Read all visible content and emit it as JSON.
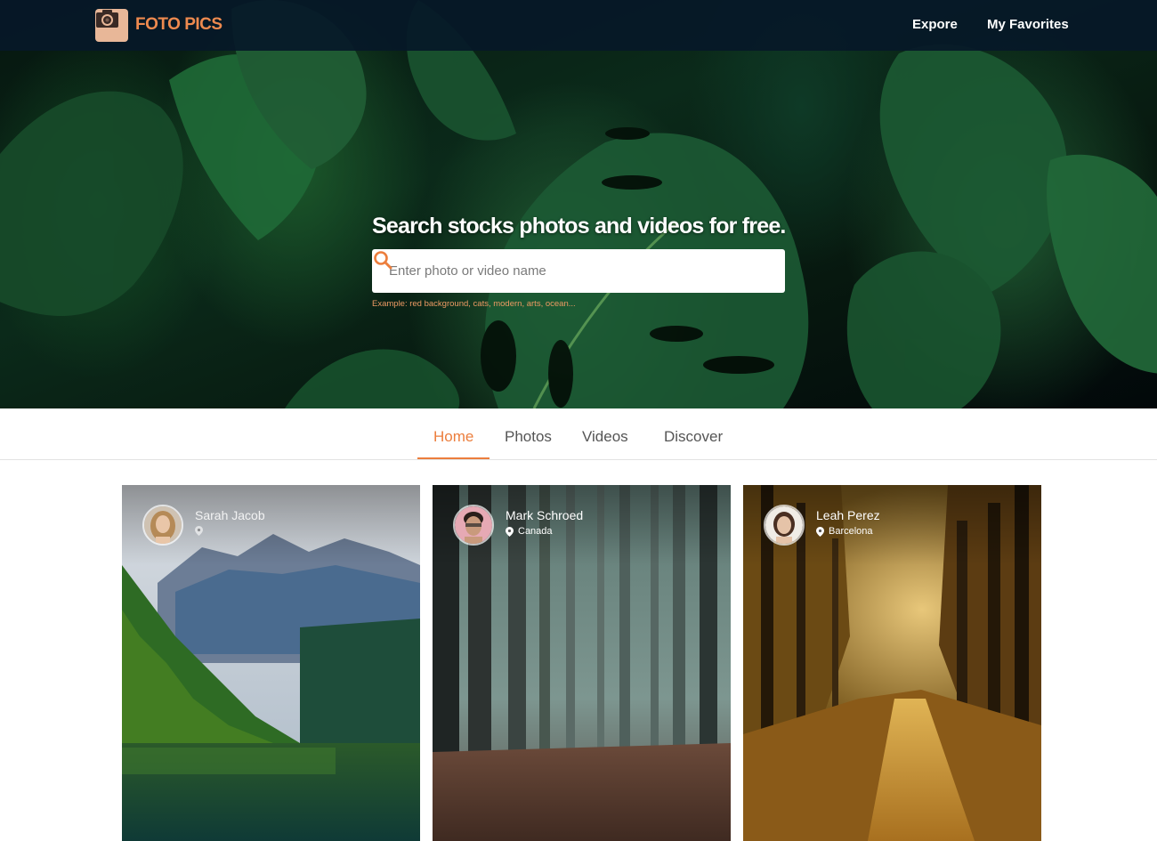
{
  "header": {
    "logo_text": "FOTO PICS",
    "logo_icon": "camera-icon",
    "nav": [
      {
        "label": "Expore"
      },
      {
        "label": "My Favorites"
      }
    ]
  },
  "hero": {
    "title": "Search stocks photos and videos for free.",
    "search": {
      "placeholder": "Enter photo or video name",
      "value": "",
      "icon": "search-icon"
    },
    "example": "Example: red background, cats, modern, arts, ocean..."
  },
  "tabs": [
    {
      "label": "Home",
      "active": true
    },
    {
      "label": "Photos",
      "active": false
    },
    {
      "label": "Videos",
      "active": false
    },
    {
      "label": "Discover",
      "active": false
    }
  ],
  "cards": [
    {
      "author": "Sarah Jacob",
      "location": "",
      "scene": "mountain-lake"
    },
    {
      "author": "Mark Schroed",
      "location": "Canada",
      "scene": "misty-forest"
    },
    {
      "author": "Leah Perez",
      "location": "Barcelona",
      "scene": "autumn-path"
    }
  ],
  "colors": {
    "accent": "#ec7e3d",
    "topbar": "#06182a",
    "logo_bg": "#e8b798"
  }
}
